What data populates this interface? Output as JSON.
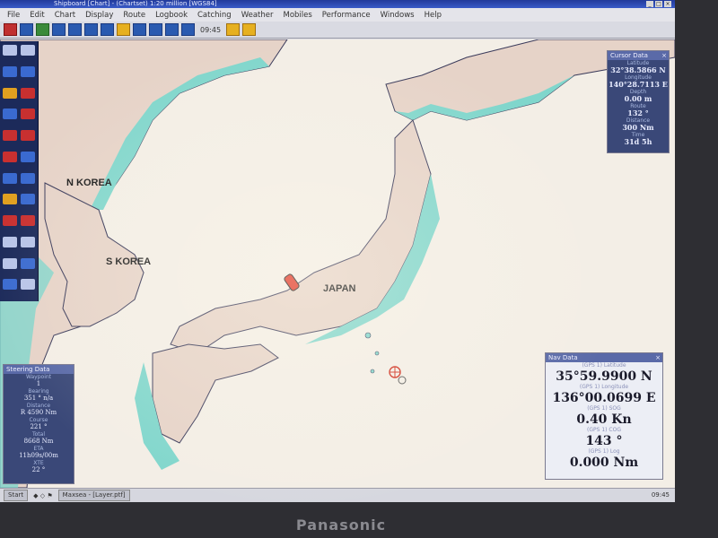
{
  "window": {
    "title": "Shipboard [Chart] - (Chartset) 1:20 million [WGS84]"
  },
  "menu": [
    "File",
    "Edit",
    "Chart",
    "Display",
    "Route",
    "Logbook",
    "Catching",
    "Weather",
    "Mobiles",
    "Performance",
    "Windows",
    "Help"
  ],
  "toolbar": {
    "time": "09:45"
  },
  "map_labels": {
    "n_korea": "N KOREA",
    "s_korea": "S KOREA",
    "japan": "JAPAN"
  },
  "cursor_data": {
    "title": "Cursor Data",
    "rows": [
      {
        "label": "Latitude",
        "value": "32°38.5866 N"
      },
      {
        "label": "Longitude",
        "value": "140°28.7113 E"
      },
      {
        "label": "Depth",
        "value": "0.00 m"
      },
      {
        "label": "Route",
        "value": "132 °"
      },
      {
        "label": "Distance",
        "value": "300 Nm"
      },
      {
        "label": "Time",
        "value": "31d 5h"
      }
    ]
  },
  "nav_data": {
    "title": "Nav Data",
    "rows": [
      {
        "label": "(GPS 1) Latitude",
        "value": "35°59.9900 N"
      },
      {
        "label": "(GPS 1) Longitude",
        "value": "136°00.0699 E"
      },
      {
        "label": "(GPS 1) SOG",
        "value": "0.40 Kn"
      },
      {
        "label": "(GPS 1) COG",
        "value": "143 °"
      },
      {
        "label": "(GPS 1) Log",
        "value": "0.000 Nm"
      }
    ]
  },
  "steering_data": {
    "title": "Steering Data",
    "rows": [
      {
        "label": "Waypoint",
        "value": "1"
      },
      {
        "label": "Bearing",
        "value": "351 ° n/a"
      },
      {
        "label": "Distance",
        "value": "R 4590 Nm"
      },
      {
        "label": "Course",
        "value": "221 °"
      },
      {
        "label": "Total",
        "value": "8668 Nm"
      },
      {
        "label": "ETA",
        "value": "11h09s/00m"
      },
      {
        "label": "XTE",
        "value": "22 °"
      }
    ]
  },
  "taskbar": {
    "start": "Start",
    "window_item": "Maxsea - [Layer.ptf]",
    "tray": "09:45"
  },
  "bezel": {
    "brand": "Panasonic"
  },
  "colors": {
    "land": "#e9d8cf",
    "sea": "#f2eee6",
    "shallow": "#7fd4cc",
    "coast": "#3a3a5a",
    "panel_dark": "#3a4878",
    "boat": "#e03020"
  }
}
